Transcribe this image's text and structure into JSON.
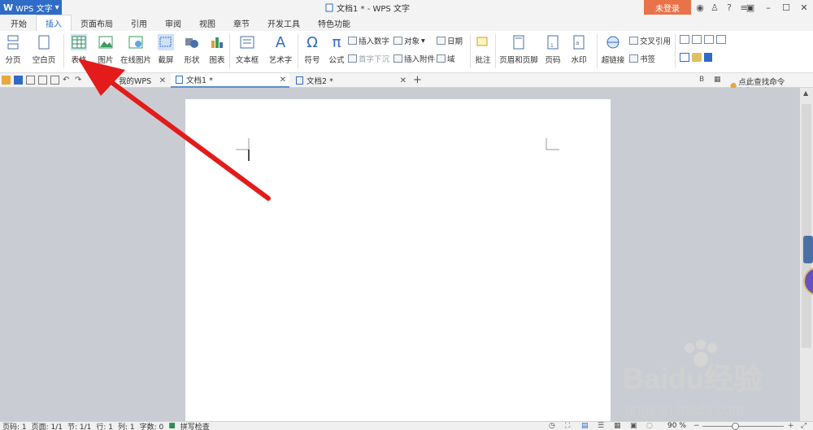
{
  "titlebar": {
    "app_label": "WPS 文字",
    "doc_title": "文档1 * - WPS 文字",
    "login": "未登录"
  },
  "tabs": [
    "开始",
    "插入",
    "页面布局",
    "引用",
    "审阅",
    "视图",
    "章节",
    "开发工具",
    "特色功能"
  ],
  "active_tab": "插入",
  "ribbon": {
    "fenye": "分页",
    "kongbaiye": "空白页",
    "biaoge": "表格",
    "tupian": "图片",
    "zaixian": "在线图片",
    "jieping": "截屏",
    "xingzhuang": "形状",
    "tubiao": "图表",
    "wenbenkuang": "文本框",
    "yishuzi": "艺术字",
    "fuhao": "符号",
    "gongshi": "公式",
    "charushuzi": "插入数字",
    "duixiang": "对象",
    "riqi": "日期",
    "shouzixiachen": "首字下沉",
    "charufujian": "插入附件",
    "yu": "域",
    "pizhu": "批注",
    "yemeiyejiao": "页眉和页脚",
    "yema": "页码",
    "shuiyin": "水印",
    "chaolianjie": "超链接",
    "jiaochayinyong": "交叉引用",
    "shuqian": "书签"
  },
  "doctabs": [
    {
      "label": "我的WPS"
    },
    {
      "label": "文档1 *"
    },
    {
      "label": "文档2 *"
    }
  ],
  "command_search": "点此查找命令 (Alt+Q)",
  "status": {
    "page": "页码: 1",
    "pages": "页面: 1/1",
    "section": "节: 1/1",
    "row": "行: 1",
    "col": "列: 1",
    "words": "字数: 0",
    "spell": "拼写检查",
    "zoom": "90 %"
  },
  "watermark": {
    "brand": "Baidu经验",
    "url": "jingyan.baidu.com"
  },
  "colors": {
    "accent": "#2f6cc7",
    "login": "#e8734a",
    "arrow": "#e31b1b"
  }
}
